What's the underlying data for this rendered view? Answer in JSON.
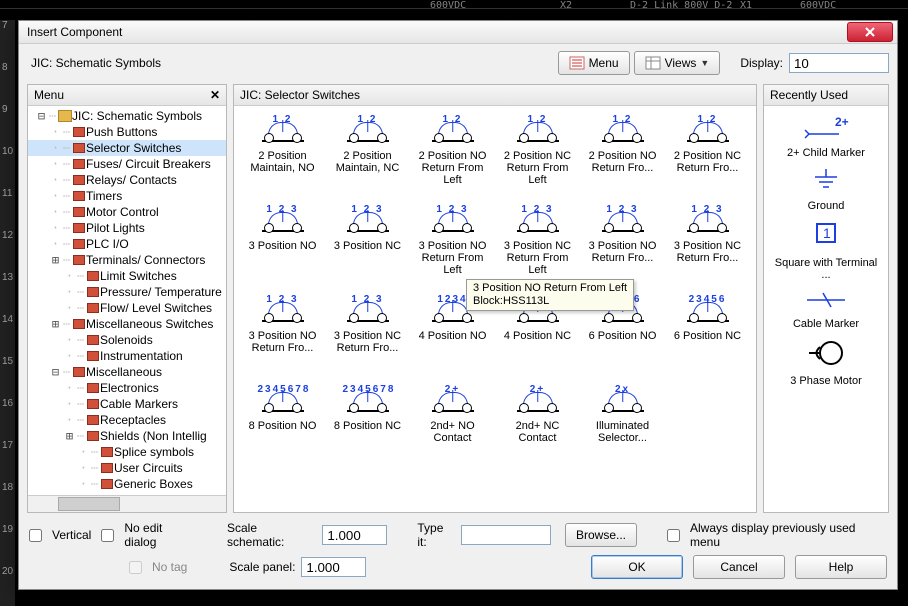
{
  "cad": {
    "labels": [
      "600VDC",
      "D-2  Link 800V D-2",
      "X1",
      "600VDC",
      "X2"
    ],
    "ruler": [
      "7",
      "8",
      "9",
      "10",
      "11",
      "12",
      "13",
      "14",
      "15",
      "16",
      "17",
      "18",
      "19",
      "20"
    ]
  },
  "dialog": {
    "title": "Insert Component",
    "breadcrumb": "JIC: Schematic Symbols",
    "menu_btn": "Menu",
    "views_btn": "Views",
    "display_label": "Display:",
    "display_value": "10"
  },
  "menu_panel": {
    "header": "Menu",
    "items": [
      {
        "depth": 0,
        "exp": "-",
        "type": "root",
        "label": "JIC: Schematic Symbols"
      },
      {
        "depth": 1,
        "exp": "",
        "type": "comp",
        "label": "Push Buttons"
      },
      {
        "depth": 1,
        "exp": "",
        "type": "comp",
        "label": "Selector Switches",
        "selected": true
      },
      {
        "depth": 1,
        "exp": "",
        "type": "comp",
        "label": "Fuses/ Circuit Breakers"
      },
      {
        "depth": 1,
        "exp": "",
        "type": "comp",
        "label": "Relays/ Contacts"
      },
      {
        "depth": 1,
        "exp": "",
        "type": "comp",
        "label": "Timers"
      },
      {
        "depth": 1,
        "exp": "",
        "type": "comp",
        "label": "Motor Control"
      },
      {
        "depth": 1,
        "exp": "",
        "type": "comp",
        "label": "Pilot Lights"
      },
      {
        "depth": 1,
        "exp": "",
        "type": "comp",
        "label": "PLC I/O"
      },
      {
        "depth": 1,
        "exp": "+",
        "type": "comp",
        "label": "Terminals/ Connectors"
      },
      {
        "depth": 2,
        "exp": "",
        "type": "comp",
        "label": "Limit Switches"
      },
      {
        "depth": 2,
        "exp": "",
        "type": "comp",
        "label": "Pressure/ Temperature"
      },
      {
        "depth": 2,
        "exp": "",
        "type": "comp",
        "label": "Flow/ Level Switches"
      },
      {
        "depth": 1,
        "exp": "+",
        "type": "comp",
        "label": "Miscellaneous Switches"
      },
      {
        "depth": 2,
        "exp": "",
        "type": "comp",
        "label": "Solenoids"
      },
      {
        "depth": 2,
        "exp": "",
        "type": "comp",
        "label": "Instrumentation"
      },
      {
        "depth": 1,
        "exp": "-",
        "type": "comp",
        "label": "Miscellaneous"
      },
      {
        "depth": 2,
        "exp": "",
        "type": "comp",
        "label": "Electronics"
      },
      {
        "depth": 2,
        "exp": "",
        "type": "comp",
        "label": "Cable Markers"
      },
      {
        "depth": 2,
        "exp": "",
        "type": "comp",
        "label": "Receptacles"
      },
      {
        "depth": 2,
        "exp": "+",
        "type": "comp",
        "label": "Shields (Non Intellig"
      },
      {
        "depth": 3,
        "exp": "",
        "type": "comp",
        "label": "Splice symbols"
      },
      {
        "depth": 3,
        "exp": "",
        "type": "comp",
        "label": "User Circuits"
      },
      {
        "depth": 3,
        "exp": "",
        "type": "comp",
        "label": "Generic Boxes"
      }
    ]
  },
  "grid_panel": {
    "header": "JIC: Selector Switches",
    "items": [
      {
        "nums": "1 2",
        "label": "2 Position Maintain, NO"
      },
      {
        "nums": "1 2",
        "label": "2 Position Maintain, NC"
      },
      {
        "nums": "1 2",
        "label": "2 Position NO Return From Left"
      },
      {
        "nums": "1 2",
        "label": "2 Position NC Return From Left"
      },
      {
        "nums": "1 2",
        "label": "2 Position NO Return Fro..."
      },
      {
        "nums": "1 2",
        "label": "2 Position NC Return Fro..."
      },
      {
        "nums": "1 2 3",
        "label": "3 Position NO"
      },
      {
        "nums": "1 2 3",
        "label": "3 Position NC"
      },
      {
        "nums": "1 2 3",
        "label": "3 Position NO Return From Left"
      },
      {
        "nums": "1 2 3",
        "label": "3 Position NC Return From Left"
      },
      {
        "nums": "1 2 3",
        "label": "3 Position NO Return Fro..."
      },
      {
        "nums": "1 2 3",
        "label": "3 Position NC Return Fro..."
      },
      {
        "nums": "1 2 3",
        "label": "3 Position NO Return Fro..."
      },
      {
        "nums": "1 2 3",
        "label": "3 Position NC Return Fro..."
      },
      {
        "nums": "1234",
        "label": "4 Position NO"
      },
      {
        "nums": "1234",
        "label": "4 Position NC"
      },
      {
        "nums": "23456",
        "label": "6 Position NO"
      },
      {
        "nums": "23456",
        "label": "6 Position NC"
      },
      {
        "nums": "2345678",
        "label": "8 Position NO"
      },
      {
        "nums": "2345678",
        "label": "8 Position NC"
      },
      {
        "nums": "2+",
        "label": "2nd+ NO Contact"
      },
      {
        "nums": "2+",
        "label": "2nd+ NC Contact"
      },
      {
        "nums": "2x",
        "label": "Illuminated Selector..."
      }
    ],
    "tooltip": {
      "line1": "3 Position NO Return From Left",
      "line2": "Block:HSS113L"
    }
  },
  "recent_panel": {
    "header": "Recently Used",
    "items": [
      {
        "glyph": "childmarker",
        "label": "2+ Child Marker"
      },
      {
        "glyph": "ground",
        "label": "Ground"
      },
      {
        "glyph": "sqterm",
        "label": "Square with Terminal ..."
      },
      {
        "glyph": "cablemarker",
        "label": "Cable Marker"
      },
      {
        "glyph": "motor",
        "label": "3 Phase Motor"
      }
    ]
  },
  "footer": {
    "vertical": "Vertical",
    "no_edit": "No edit dialog",
    "no_tag": "No tag",
    "scale_schem_label": "Scale schematic:",
    "scale_schem_value": "1.000",
    "scale_panel_label": "Scale panel:",
    "scale_panel_value": "1.000",
    "type_it_label": "Type it:",
    "type_it_value": "",
    "browse": "Browse...",
    "always_display": "Always display previously used menu",
    "ok": "OK",
    "cancel": "Cancel",
    "help": "Help"
  }
}
